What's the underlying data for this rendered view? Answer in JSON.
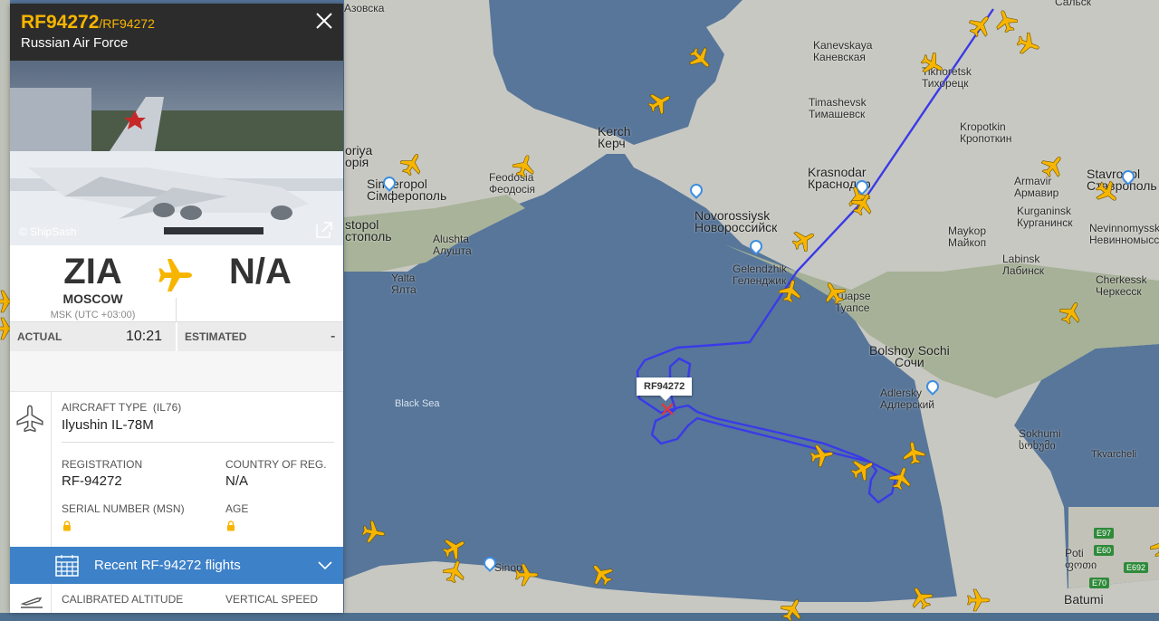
{
  "panel": {
    "callsign": "RF94272",
    "callsign_alt": "/RF94272",
    "airline": "Russian Air Force",
    "photo_credit": "© ShipSash",
    "origin": {
      "code": "ZIA",
      "city": "MOSCOW",
      "timezone": "MSK (UTC +03:00)"
    },
    "destination": {
      "code": "N/A"
    },
    "times": {
      "actual_label": "ACTUAL",
      "actual_value": "10:21",
      "estimated_label": "ESTIMATED",
      "estimated_value": "-"
    },
    "aircraft": {
      "type_label": "AIRCRAFT TYPE",
      "type_code": "(IL76)",
      "type_value": "Ilyushin IL-78M",
      "registration_label": "REGISTRATION",
      "registration_value": "RF-94272",
      "country_label": "COUNTRY OF REG.",
      "country_value": "N/A",
      "serial_label": "SERIAL NUMBER (MSN)",
      "age_label": "AGE"
    },
    "recent_flights_label": "Recent RF-94272 flights",
    "altitude_label": "CALIBRATED ALTITUDE",
    "vertical_speed_label": "VERTICAL SPEED"
  },
  "map": {
    "flight_tag": "RF94272",
    "labels": {
      "kanevskaya": [
        "Kanevskaya",
        "Каневская"
      ],
      "timashevsk": [
        "Timashevsk",
        "Тимашевск"
      ],
      "tikhoretsk": [
        "Tikhoretsk",
        "Тихорецк"
      ],
      "kropotkin": [
        "Kropotkin",
        "Кропоткин"
      ],
      "kerch": [
        "Kerch",
        "Керч"
      ],
      "feodosia": [
        "Feodosia",
        "Феодосія"
      ],
      "simferopol": [
        "Simferopol",
        "Сімферополь"
      ],
      "sevastopol": [
        "stopol",
        "стополь"
      ],
      "evpatoria": [
        "oriya",
        "орія"
      ],
      "alushta": [
        "Alushta",
        "Алушта"
      ],
      "yalta": [
        "Yalta",
        "Ялта"
      ],
      "krasnodar": [
        "Krasnodar",
        "Краснодар"
      ],
      "armavir": [
        "Armavir",
        "Армавир"
      ],
      "kurganinsk": [
        "Kurganinsk",
        "Курганинск"
      ],
      "stavropol": [
        "Stavropol",
        "Ставрополь"
      ],
      "novorossiysk": [
        "Novorossiysk",
        "Новороссийск"
      ],
      "gelendzhik": [
        "Gelendzhik",
        "Геленджик"
      ],
      "maykop": [
        "Maykop",
        "Майкоп"
      ],
      "labinsk": [
        "Labinsk",
        "Лабинск"
      ],
      "nevinnomyssk": [
        "Nevinnomyssk",
        "Невинномысск"
      ],
      "cherkessk": [
        "Cherkessk",
        "Черкесск"
      ],
      "tuapse": [
        "Tuapse",
        "Туапсе"
      ],
      "sochi": [
        "Bolshoy Sochi",
        "Сочи"
      ],
      "adlersky": [
        "Adlersky",
        "Адлерский"
      ],
      "sokhumi": [
        "Sokhumi",
        "სოხუმი"
      ],
      "tkvarcheli": [
        "Tkvarcheli"
      ],
      "poti": [
        "Poti",
        "ფოთი"
      ],
      "batumi": [
        "Batumi"
      ],
      "salsk": [
        "Сальск"
      ],
      "azovska": [
        "Азовска"
      ],
      "black_sea": [
        "Black Sea"
      ],
      "sinop": [
        "Sinop"
      ]
    },
    "roads": [
      "E97",
      "E60",
      "E70",
      "E692"
    ]
  },
  "colors": {
    "accent": "#f7b500",
    "track": "#3a3ae8",
    "panel_header": "#2c2c2c",
    "recent_bar": "#3d81c8"
  }
}
